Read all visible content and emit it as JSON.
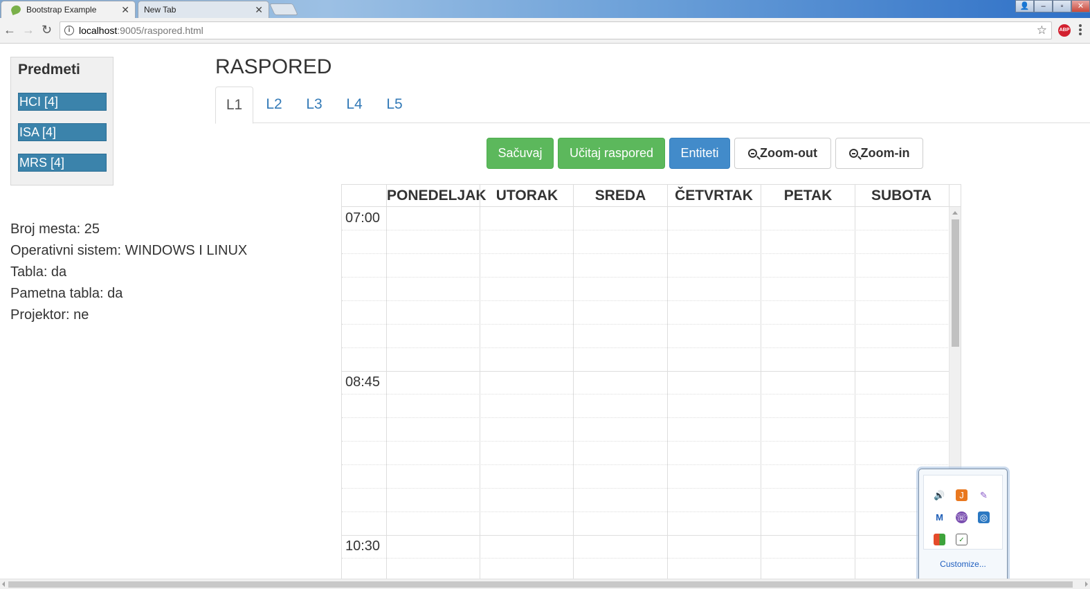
{
  "browser": {
    "tabs": [
      {
        "title": "Bootstrap Example",
        "active": true
      },
      {
        "title": "New Tab",
        "active": false
      }
    ],
    "address": {
      "host": "localhost",
      "rest": ":9005/raspored.html"
    }
  },
  "sidebar": {
    "title": "Predmeti",
    "subjects": [
      "HCI [4]",
      "ISA [4]",
      "MRS [4]"
    ]
  },
  "info": {
    "lines": [
      "Broj mesta: 25",
      "Operativni sistem: WINDOWS I LINUX",
      "Tabla: da",
      "Pametna tabla: da",
      "Projektor: ne"
    ]
  },
  "page": {
    "title": "RASPORED",
    "tabs": [
      "L1",
      "L2",
      "L3",
      "L4",
      "L5"
    ],
    "active_tab": "L1"
  },
  "toolbar": {
    "save": "Sačuvaj",
    "load": "Učitaj raspored",
    "entities": "Entiteti",
    "zoom_out": "Zoom-out",
    "zoom_in": "Zoom-in"
  },
  "schedule": {
    "days": [
      "PONEDELJAK",
      "UTORAK",
      "SREDA",
      "ČETVRTAK",
      "PETAK",
      "SUBOTA"
    ],
    "times": [
      "07:00",
      "08:45",
      "10:30"
    ]
  },
  "tray": {
    "customize": "Customize...",
    "icons": [
      "speaker-icon",
      "java-icon",
      "feather-icon",
      "malwarebytes-icon",
      "viber-icon",
      "network-icon",
      "windows-flag-icon",
      "clipboard-icon"
    ]
  },
  "colors": {
    "subject_bg": "#3b83ab",
    "success": "#5cb85c",
    "primary": "#428bca",
    "link": "#337ab7"
  }
}
